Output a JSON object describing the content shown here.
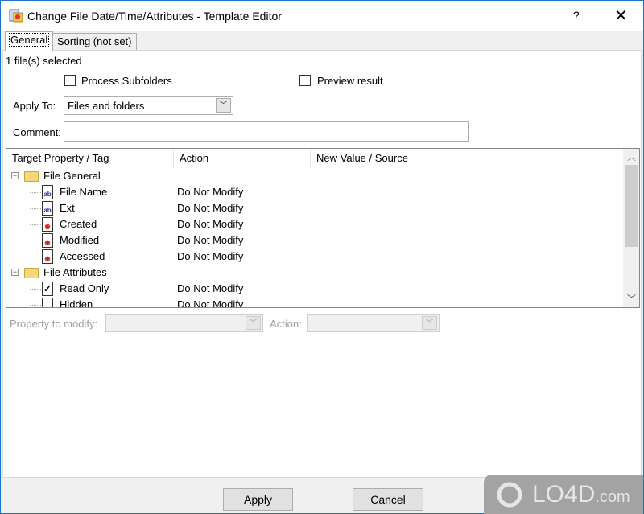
{
  "window": {
    "title": "Change File Date/Time/Attributes - Template Editor",
    "help": "?",
    "close": "✕"
  },
  "tabs": [
    {
      "label": "General",
      "active": true
    },
    {
      "label": "Sorting (not set)",
      "active": false
    }
  ],
  "general": {
    "selection_status": "1 file(s) selected",
    "process_subfolders": {
      "label": "Process Subfolders",
      "checked": false
    },
    "preview_result": {
      "label": "Preview result",
      "checked": false
    },
    "apply_to": {
      "label": "Apply To:",
      "value": "Files and folders"
    },
    "comment": {
      "label": "Comment:",
      "value": ""
    }
  },
  "list": {
    "columns": [
      "Target Property / Tag",
      "Action",
      "New Value / Source"
    ],
    "rows": [
      {
        "type": "group",
        "label": "File General",
        "expanded": true
      },
      {
        "type": "item",
        "icon": "text-file-icon",
        "label": "File Name",
        "action": "Do Not Modify"
      },
      {
        "type": "item",
        "icon": "text-file-icon",
        "label": "Ext",
        "action": "Do Not Modify"
      },
      {
        "type": "item",
        "icon": "date-file-icon",
        "label": "Created",
        "action": "Do Not Modify"
      },
      {
        "type": "item",
        "icon": "date-file-icon",
        "label": "Modified",
        "action": "Do Not Modify"
      },
      {
        "type": "item",
        "icon": "date-file-icon",
        "label": "Accessed",
        "action": "Do Not Modify"
      },
      {
        "type": "group",
        "label": "File Attributes",
        "expanded": true
      },
      {
        "type": "item",
        "icon": "checked-file-icon",
        "label": "Read Only",
        "action": "Do Not Modify"
      },
      {
        "type": "item",
        "icon": "file-icon",
        "label": "Hidden",
        "action": "Do Not Modify"
      }
    ]
  },
  "editor": {
    "property_label": "Property to modify:",
    "property_value": "",
    "action_label": "Action:",
    "action_value": ""
  },
  "buttons": {
    "apply": "Apply",
    "cancel": "Cancel"
  },
  "watermark": "LO4D.com"
}
